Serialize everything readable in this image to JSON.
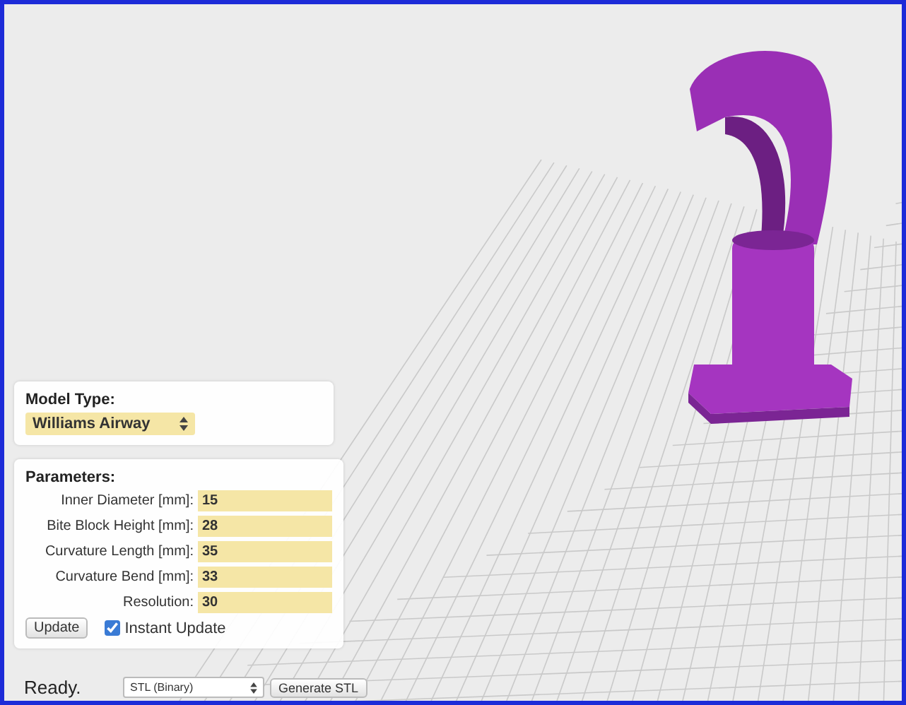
{
  "model_type": {
    "label": "Model Type:",
    "value": "Williams Airway"
  },
  "parameters": {
    "label": "Parameters:",
    "fields": [
      {
        "label": "Inner Diameter [mm]:",
        "value": "15"
      },
      {
        "label": "Bite Block Height [mm]:",
        "value": "28"
      },
      {
        "label": "Curvature Length [mm]:",
        "value": "35"
      },
      {
        "label": "Curvature Bend [mm]:",
        "value": "33"
      },
      {
        "label": "Resolution:",
        "value": "30"
      }
    ],
    "update_button": "Update",
    "instant_update": {
      "label": "Instant Update",
      "checked": true
    }
  },
  "status_bar": {
    "status": "Ready.",
    "format": "STL (Binary)",
    "generate_button": "Generate STL"
  }
}
